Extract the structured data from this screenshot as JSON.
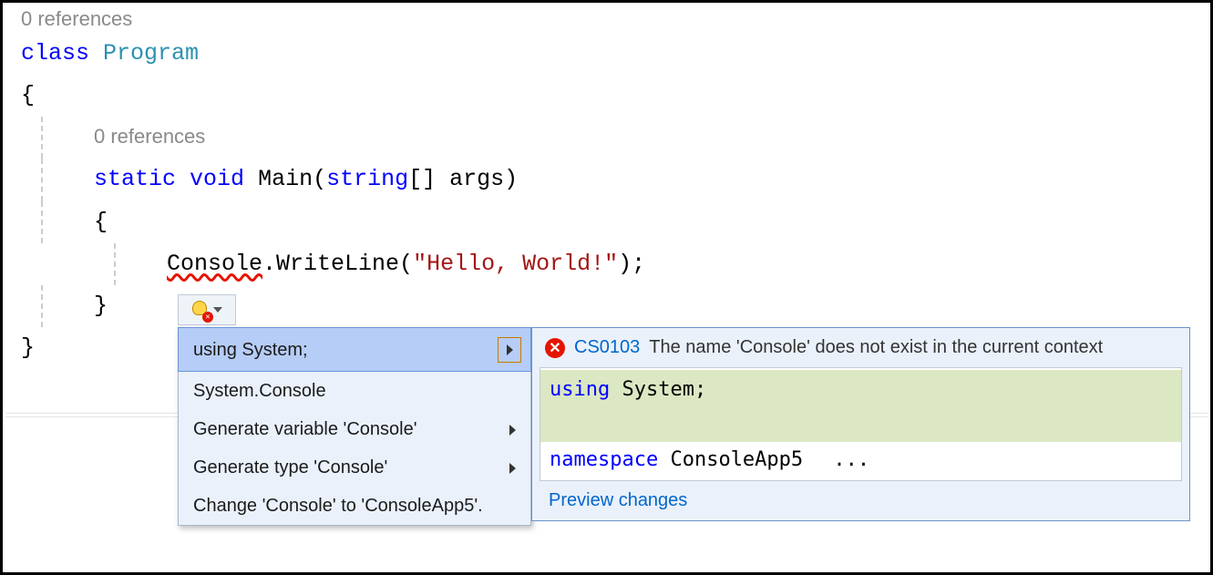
{
  "editor": {
    "codelens1": "0 references",
    "codelens2": "0 references",
    "kw_class": "class",
    "class_name": "Program",
    "brace_open": "{",
    "brace_close": "}",
    "kw_static": "static",
    "kw_void": "void",
    "method_name": "Main",
    "paren_open": "(",
    "kw_string": "string",
    "brackets": "[]",
    "param": " args",
    "paren_close": ")",
    "console": "Console",
    "dot_write": ".WriteLine(",
    "string_literal": "\"Hello, World!\"",
    "close_stmt": ");"
  },
  "quickfix": {
    "items": [
      {
        "label": "using System;",
        "has_sub": true,
        "selected": true
      },
      {
        "label": "System.Console",
        "has_sub": false,
        "selected": false
      },
      {
        "label": "Generate variable 'Console'",
        "has_sub": true,
        "selected": false
      },
      {
        "label": "Generate type 'Console'",
        "has_sub": true,
        "selected": false
      },
      {
        "label": "Change 'Console' to 'ConsoleApp5'.",
        "has_sub": false,
        "selected": false
      }
    ]
  },
  "preview": {
    "error_code": "CS0103",
    "error_msg": "The name 'Console' does not exist in the current context",
    "diff": {
      "kw_using": "using",
      "using_rest": " System;",
      "kw_namespace": "namespace",
      "ns_rest": " ConsoleApp5",
      "ellipsis": "..."
    },
    "footer_link": "Preview changes"
  }
}
